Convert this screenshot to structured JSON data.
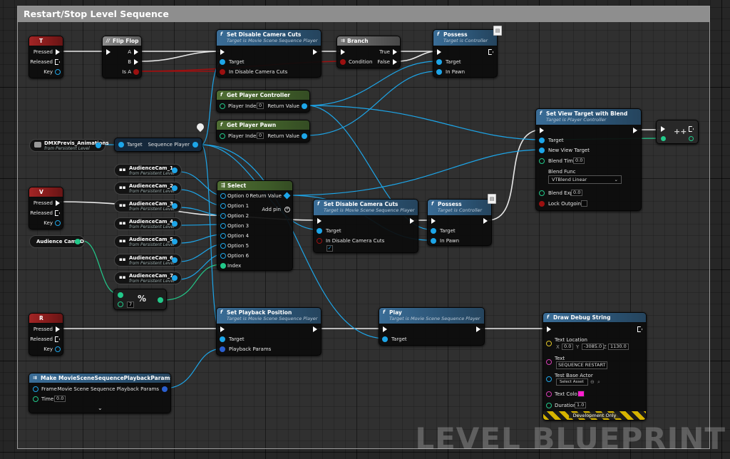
{
  "comment_title": "Restart/Stop Level Sequence",
  "watermark": "LEVEL BLUEPRINT",
  "nodes": {
    "key_t": {
      "title": "T",
      "pins": [
        "Pressed",
        "Released",
        "Key"
      ]
    },
    "flipflop": {
      "title": "Flip Flop",
      "pins": [
        "A",
        "B",
        "Is A"
      ]
    },
    "set_disable_cam_1": {
      "title": "Set Disable Camera Cuts",
      "subtitle": "Target is Movie Scene Sequence Player",
      "pins": [
        "Target",
        "In Disable Camera Cuts"
      ]
    },
    "branch": {
      "title": "Branch",
      "pins": [
        "Condition",
        "True",
        "False"
      ]
    },
    "possess_1": {
      "title": "Possess",
      "subtitle": "Target is Controller",
      "pins": [
        "Target",
        "In Pawn"
      ]
    },
    "get_player_controller": {
      "title": "Get Player Controller",
      "pins": [
        "Player Index",
        "Return Value"
      ],
      "player_index": "0"
    },
    "get_player_pawn": {
      "title": "Get Player Pawn",
      "pins": [
        "Player Index",
        "Return Value"
      ],
      "player_index": "0"
    },
    "set_view_target": {
      "title": "Set View Target with Blend",
      "subtitle": "Target is Player Controller",
      "pins": [
        "Target",
        "New View Target",
        "Blend Time",
        "Blend Func",
        "Blend Exp",
        "Lock Outgoing"
      ],
      "blend_time": "0.0",
      "blend_func": "VTBlend Linear",
      "blend_exp": "0.0"
    },
    "dmx_var": {
      "name": "DMXPrevis_Animations",
      "sub": "from Persistent Level"
    },
    "seq_player": {
      "pins": [
        "Target",
        "Sequence Player"
      ]
    },
    "key_v": {
      "title": "V",
      "pins": [
        "Pressed",
        "Released",
        "Key"
      ]
    },
    "audience_cams": [
      {
        "name": "AudienceCam_1",
        "sub": "from Persistent Level"
      },
      {
        "name": "AudienceCam_2",
        "sub": "from Persistent Level"
      },
      {
        "name": "AudienceCam_3",
        "sub": "from Persistent Level"
      },
      {
        "name": "AudienceCam_4",
        "sub": "from Persistent Level"
      },
      {
        "name": "AudienceCam_5",
        "sub": "from Persistent Level"
      },
      {
        "name": "AudienceCam_6",
        "sub": "from Persistent Level"
      },
      {
        "name": "AudienceCam_7",
        "sub": "from Persistent Level"
      }
    ],
    "audience_cam_id": {
      "name": "Audience Cam ID"
    },
    "modulo": {
      "symbol": "%",
      "value": "7"
    },
    "select": {
      "title": "Select",
      "options": [
        "Option 0",
        "Option 1",
        "Option 2",
        "Option 3",
        "Option 4",
        "Option 5",
        "Option 6"
      ],
      "index": "Index",
      "return_value": "Return Value",
      "add_pin": "Add pin"
    },
    "set_disable_cam_2": {
      "title": "Set Disable Camera Cuts",
      "subtitle": "Target is Movie Scene Sequence Player",
      "pins": [
        "Target",
        "In Disable Camera Cuts"
      ]
    },
    "possess_2": {
      "title": "Possess",
      "subtitle": "Target is Controller",
      "pins": [
        "Target",
        "In Pawn"
      ]
    },
    "sequence_node": {
      "symbol": "++"
    },
    "key_r": {
      "title": "R",
      "pins": [
        "Pressed",
        "Released",
        "Key"
      ]
    },
    "set_playback_position": {
      "title": "Set Playback Position",
      "subtitle": "Target is Movie Scene Sequence Player",
      "pins": [
        "Target",
        "Playback Params"
      ]
    },
    "play": {
      "title": "Play",
      "subtitle": "Target is Movie Scene Sequence Player",
      "pins": [
        "Target"
      ]
    },
    "make_params": {
      "title": "Make MovieSceneSequencePlaybackParams",
      "pins": [
        "Frame",
        "Time",
        "Movie Scene Sequence Playback Params"
      ],
      "time": "0.0"
    },
    "draw_debug": {
      "title": "Draw Debug String",
      "pins": [
        "Text Location",
        "Text",
        "Test Base Actor",
        "Text Color",
        "Duration"
      ],
      "loc_x_label": "X",
      "loc_x": "0.0",
      "loc_y_label": "Y",
      "loc_y": "-3085.0",
      "loc_z_label": "Z",
      "loc_z": "1130.0",
      "text": "SEQUENCE RESTART",
      "actor": "Select Asset",
      "duration": "1.0",
      "banner": "Development Only"
    }
  },
  "colors": {
    "exec": "#ffffff",
    "object": "#1da5e8",
    "bool": "#9b1010",
    "int": "#22c98a",
    "vector": "#e0c528",
    "text": "#d63db4",
    "text_color": "#ff1ecf"
  }
}
